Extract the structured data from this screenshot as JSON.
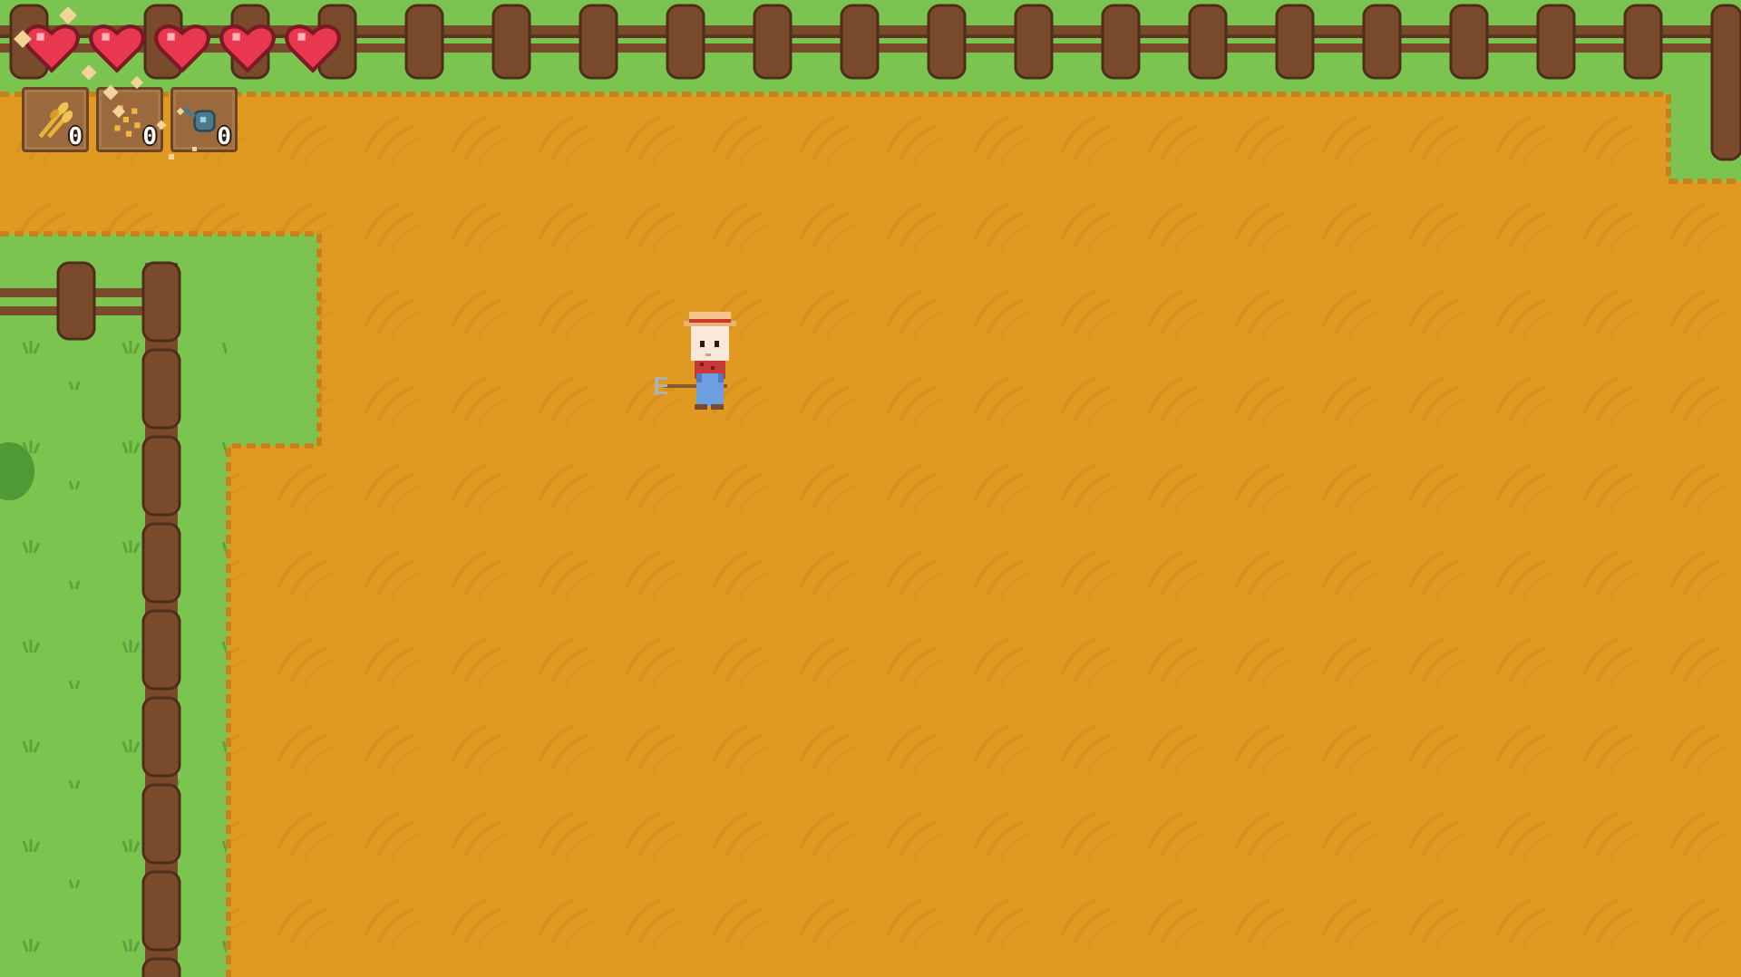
{
  "hud": {
    "hearts": [
      {
        "name": "heart-1",
        "filled": true
      },
      {
        "name": "heart-2",
        "filled": true
      },
      {
        "name": "heart-3",
        "filled": true
      },
      {
        "name": "heart-4",
        "filled": true
      },
      {
        "name": "heart-5",
        "filled": true
      }
    ],
    "inventory": [
      {
        "item": "wheat-icon",
        "count": "0"
      },
      {
        "item": "seeds-icon",
        "count": "0"
      },
      {
        "item": "watering-can-icon",
        "count": "0"
      }
    ]
  },
  "player": {
    "tool": "pitchfork-icon",
    "facing": "left"
  },
  "colors": {
    "grass": "#7cc450",
    "soil": "#e09a22",
    "fence": "#7a4a2c",
    "heart": "#e8374f",
    "slot": "#9a6a3e"
  }
}
